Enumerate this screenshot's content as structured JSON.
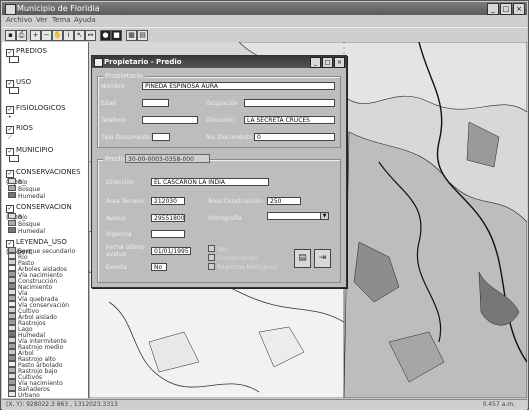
{
  "app": {
    "title": "Municipio de Floridia",
    "menu": [
      "Archivo",
      "Ver",
      "Tema",
      "Ayuda"
    ],
    "status_left": "(X, Y): 928022.3 863 , 1312023.3313",
    "status_right": "0.457 a.m."
  },
  "toolbar": {
    "icons": [
      "save-icon",
      "print-icon",
      "zoom-in-icon",
      "zoom-out-icon",
      "pan-icon",
      "identify-icon",
      "select-icon",
      "measure-icon",
      "info-icon",
      "layers-icon",
      "table-icon",
      "chart-icon"
    ]
  },
  "legend": {
    "layers": [
      {
        "name": "PREDIOS",
        "checked": true
      },
      {
        "name": "USO",
        "checked": true
      },
      {
        "name": "FISIOLOGICOS",
        "checked": true
      },
      {
        "name": "RIOS",
        "checked": true
      },
      {
        "name": "MUNICIPIO",
        "checked": true
      },
      {
        "name": "CONSERVACIONES (tipo_",
        "checked": true,
        "items": [
          "Río",
          "Bosque",
          "Humedal"
        ]
      },
      {
        "name": "CONSERVACION (tipo_",
        "checked": true,
        "items": [
          "Río",
          "Bosque",
          "Humedal"
        ]
      },
      {
        "name": "LEYENDA_USO (cobert",
        "checked": true,
        "items": [
          "Bosque secundario",
          "Río",
          "Pasto",
          "Árboles aislados",
          "Vía nacimiento",
          "Construcción",
          "Nacimiento",
          "Vía",
          "Vía quebrada",
          "Vía conservación",
          "Cultivo",
          "Árbol aislado",
          "Rastrojos",
          "Lago",
          "Humedal",
          "Vía intermitente",
          "Rastrojo medio",
          "Árbol",
          "Rastrojo alto",
          "Pasto arbolado",
          "Rastrojo bajo",
          "Cultivos",
          "Vía nacimiento",
          "Bañaderos",
          "Urbano"
        ]
      }
    ]
  },
  "dialog": {
    "title": "Propietario - Predio",
    "propietario": {
      "legend": "Propietario",
      "nombre_label": "Nombre",
      "nombre": "PINEDA ESPINOSA AURA",
      "edad_label": "Edad",
      "edad": "",
      "ocupacion_label": "Ocupación",
      "ocupacion": "",
      "telefono_label": "Telefono",
      "telefono": "",
      "direccion_label": "Dirección",
      "direccion": "LA SECRETA CRUCES",
      "tipo_doc_label": "Tipo Documento",
      "tipo_doc": "",
      "no_doc_label": "No. Documento",
      "no_doc": "0"
    },
    "predio": {
      "legend": "Predio",
      "codigo": "30-00-0003-0358-000",
      "direccion_label": "Dirección",
      "direccion": "EL CASCARON LA INDIA",
      "area_terreno_label": "Área Terreno",
      "area_terreno": "212030",
      "area_construccion_label": "Área Construcción",
      "area_construccion": "250",
      "avaluo_label": "Avaluo",
      "avaluo": "29551800",
      "hidrografia_label": "Hidrografía",
      "hidrografia": "",
      "vigencia_label": "Vigencia",
      "vigencia": "",
      "fecha_label": "Fecha último avaluo",
      "fecha": "01/01/1995",
      "exenta_label": "Exenta",
      "exenta": "No",
      "checks": [
        "Uso",
        "Conservación",
        "Registros Biológicos"
      ]
    },
    "buttons": {
      "save": "save-icon",
      "exit": "exit-icon"
    }
  },
  "colors": {
    "titlebar": "#5a5a5a",
    "dialog_bg": "#bdbdbd",
    "map_bg": "#d5d5d5"
  }
}
